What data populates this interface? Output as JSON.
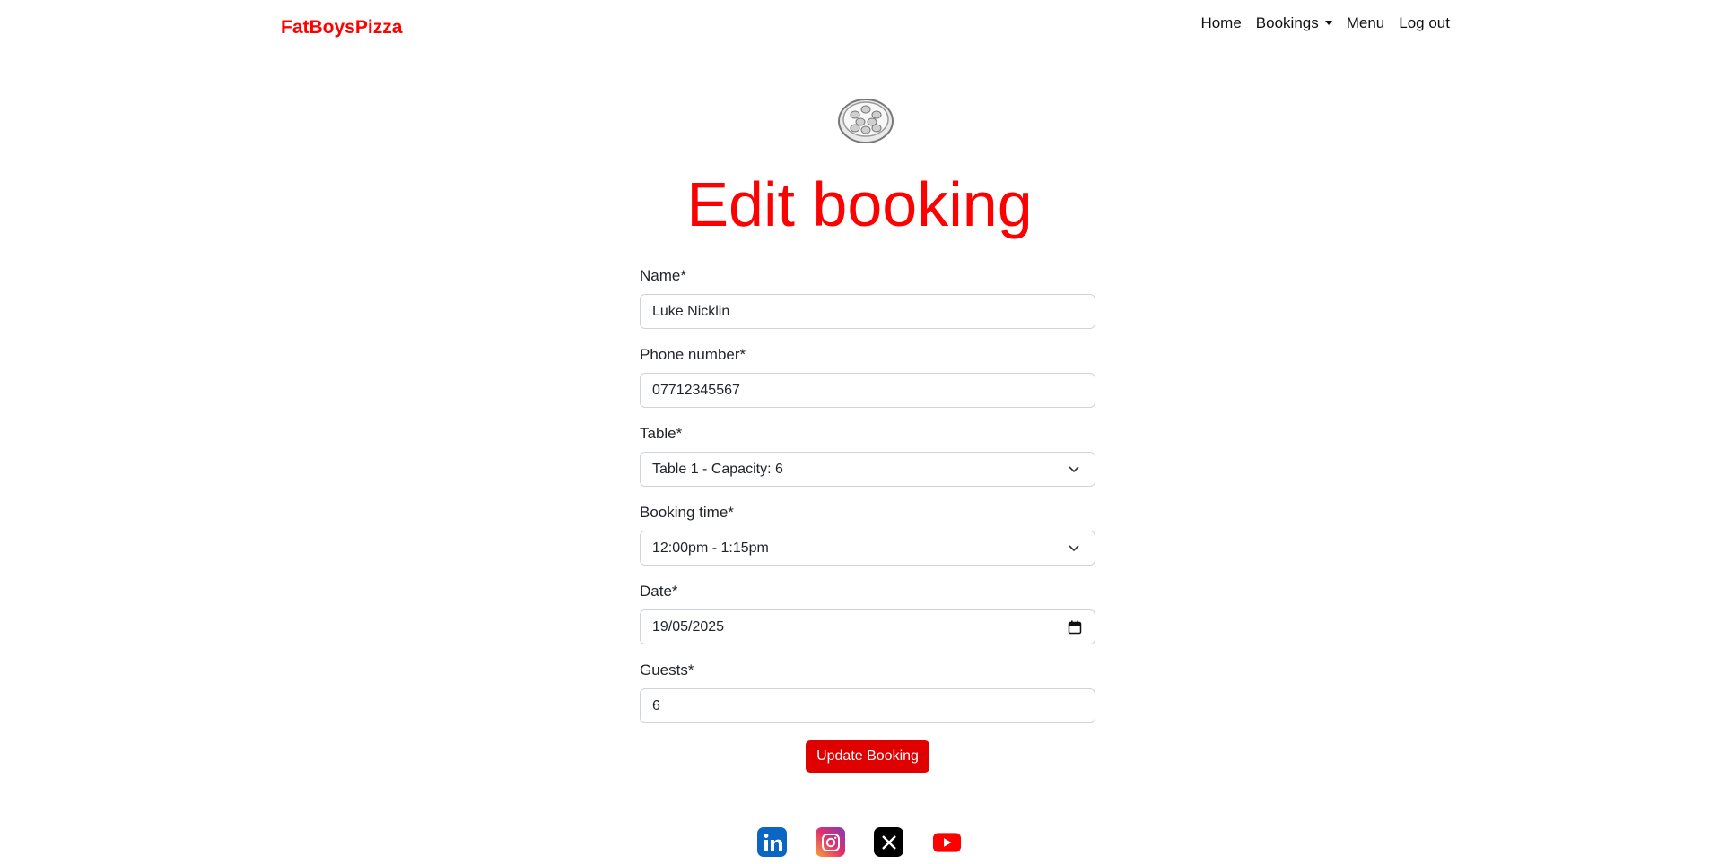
{
  "brand": "FatBoysPizza",
  "nav": {
    "home": "Home",
    "bookings": "Bookings",
    "menu": "Menu",
    "logout": "Log out"
  },
  "page_title": "Edit booking",
  "form": {
    "name": {
      "label": "Name*",
      "value": "Luke Nicklin"
    },
    "phone": {
      "label": "Phone number*",
      "value": "07712345567"
    },
    "table": {
      "label": "Table*",
      "value": "Table 1 - Capacity: 6"
    },
    "booking_time": {
      "label": "Booking time*",
      "value": "12:00pm - 1:15pm"
    },
    "date": {
      "label": "Date*",
      "value": "19/05/2025"
    },
    "guests": {
      "label": "Guests*",
      "value": "6"
    },
    "submit": "Update Booking"
  },
  "colors": {
    "brand": "#ff0000",
    "button": "#e00000"
  },
  "social": [
    "linkedin-icon",
    "instagram-icon",
    "x-icon",
    "youtube-icon"
  ]
}
